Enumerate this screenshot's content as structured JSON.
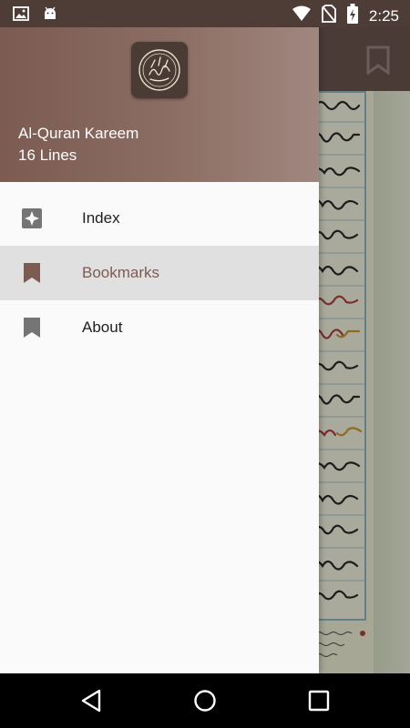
{
  "status_bar": {
    "time": "2:25",
    "left_icons": [
      "image-icon",
      "android-icon"
    ],
    "right_icons": [
      "wifi-icon",
      "no-sim-icon",
      "battery-charging-icon"
    ]
  },
  "drawer": {
    "header": {
      "app_name": "Al-Quran Kareem",
      "subtitle": "16 Lines",
      "logo_icon": "quran-logo-icon"
    },
    "items": [
      {
        "label": "Index",
        "icon": "index-icon",
        "selected": false
      },
      {
        "label": "Bookmarks",
        "icon": "bookmark-icon",
        "selected": true
      },
      {
        "label": "About",
        "icon": "bookmark-icon",
        "selected": false
      }
    ]
  },
  "toolbar": {
    "bookmark_icon": "bookmark-outline-icon"
  },
  "nav_bar": {
    "buttons": [
      "back-icon",
      "home-icon",
      "recents-icon"
    ]
  },
  "colors": {
    "primary": "#7b5b52",
    "header_end": "#a0877f",
    "status_bar": "#4e3c37",
    "selected_bg": "#e0e0e0",
    "drawer_bg": "#fafafa"
  }
}
